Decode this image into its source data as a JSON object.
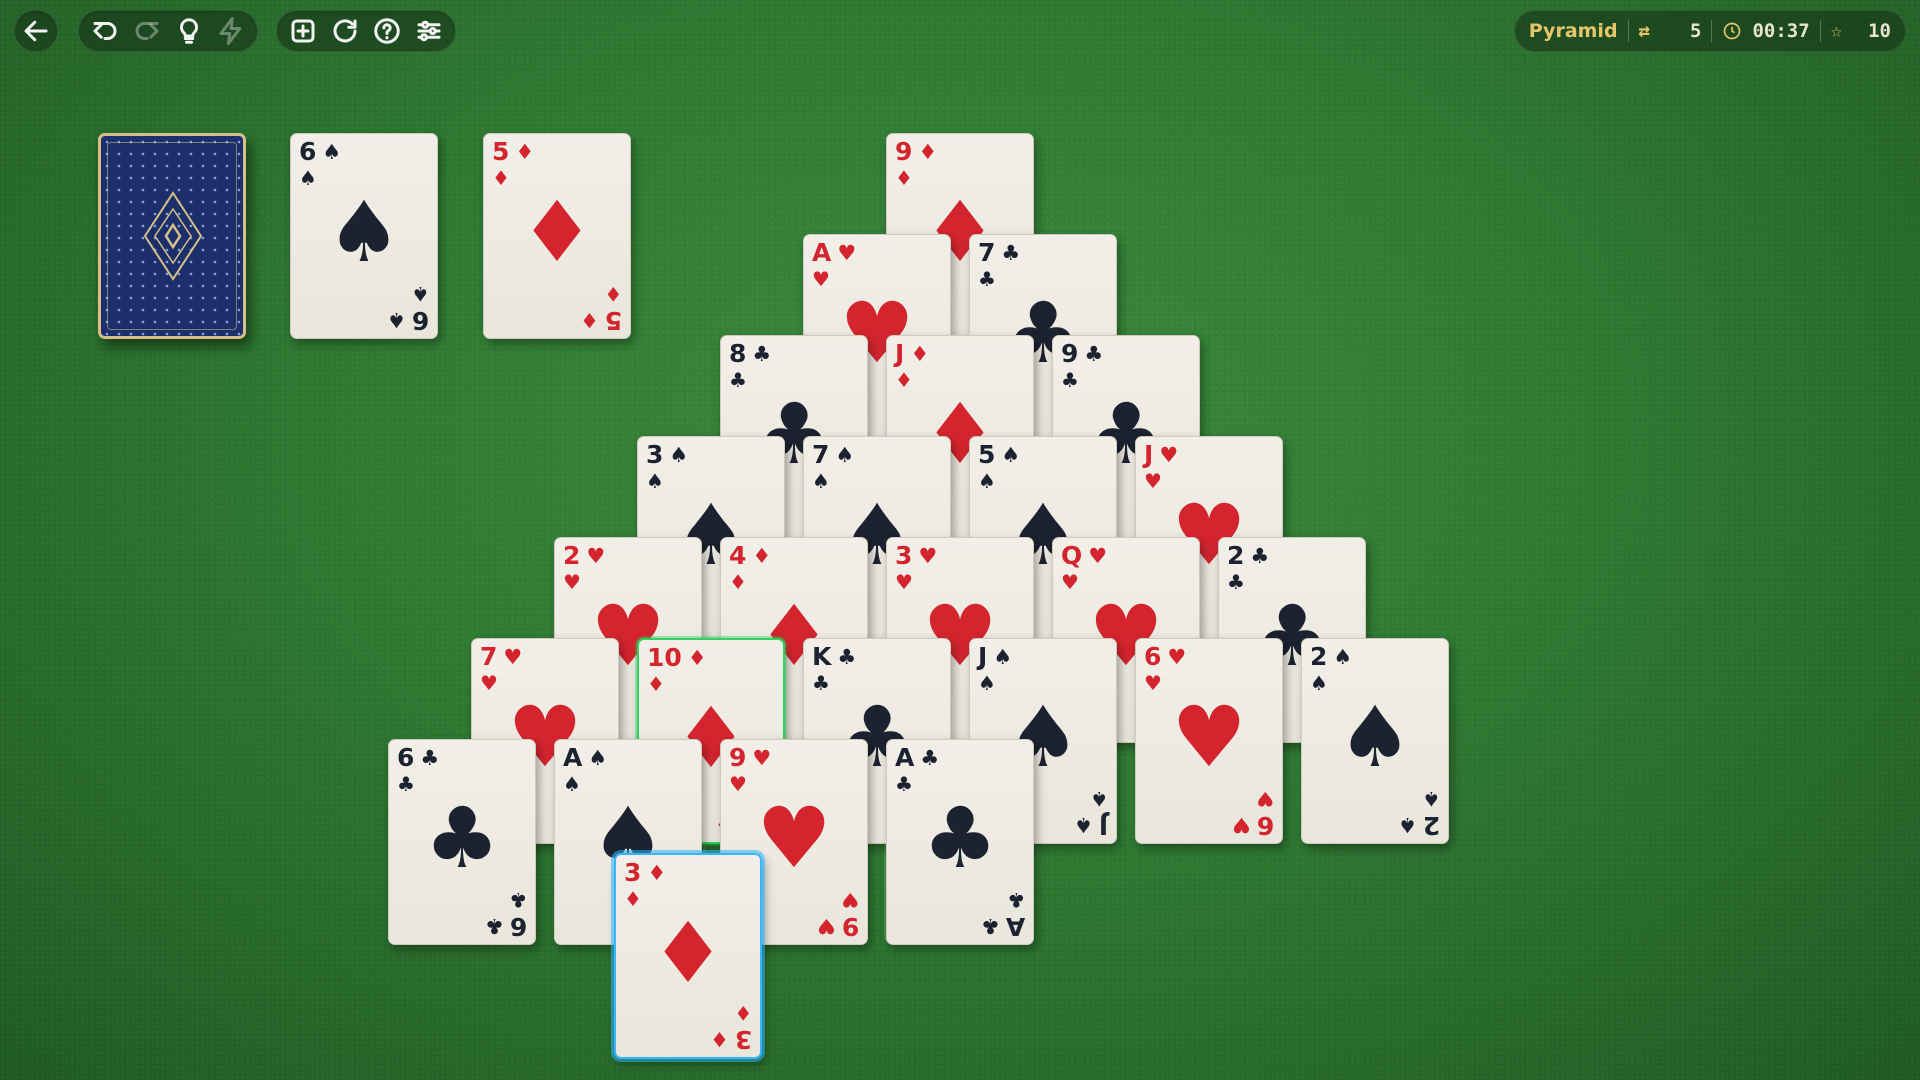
{
  "toolbar": {
    "buttons": [
      "back",
      "undo",
      "redo",
      "hint",
      "auto",
      "new-game",
      "restart",
      "help",
      "settings"
    ]
  },
  "status": {
    "mode": "Pyramid",
    "passes": "5",
    "time": "00:37",
    "score": "10"
  },
  "colors": {
    "red": "#d4252f",
    "black": "#1d2230",
    "felt": "#2f7a33",
    "accent": "#e7c66a"
  },
  "stock": {
    "face": "down"
  },
  "waste": [
    {
      "rank": "6",
      "suit": "♠",
      "color": "black"
    },
    {
      "rank": "5",
      "suit": "♦",
      "color": "red"
    }
  ],
  "pyramid": [
    {
      "rank": "9",
      "suit": "♦",
      "color": "red"
    },
    {
      "rank": "A",
      "suit": "♥",
      "color": "red"
    },
    {
      "rank": "7",
      "suit": "♣",
      "color": "black"
    },
    {
      "rank": "8",
      "suit": "♣",
      "color": "black"
    },
    {
      "rank": "J",
      "suit": "♦",
      "color": "red"
    },
    {
      "rank": "9",
      "suit": "♣",
      "color": "black"
    },
    {
      "rank": "3",
      "suit": "♠",
      "color": "black"
    },
    {
      "rank": "7",
      "suit": "♠",
      "color": "black"
    },
    {
      "rank": "5",
      "suit": "♠",
      "color": "black"
    },
    {
      "rank": "J",
      "suit": "♥",
      "color": "red"
    },
    {
      "rank": "2",
      "suit": "♥",
      "color": "red"
    },
    {
      "rank": "4",
      "suit": "♦",
      "color": "red"
    },
    {
      "rank": "3",
      "suit": "♥",
      "color": "red"
    },
    {
      "rank": "Q",
      "suit": "♥",
      "color": "red"
    },
    {
      "rank": "2",
      "suit": "♣",
      "color": "black"
    },
    {
      "rank": "7",
      "suit": "♥",
      "color": "red"
    },
    {
      "rank": "10",
      "suit": "♦",
      "color": "red",
      "selected": "green"
    },
    {
      "rank": "K",
      "suit": "♣",
      "color": "black"
    },
    {
      "rank": "J",
      "suit": "♠",
      "color": "black"
    },
    {
      "rank": "6",
      "suit": "♥",
      "color": "red"
    },
    {
      "rank": "2",
      "suit": "♠",
      "color": "black"
    },
    {
      "rank": "6",
      "suit": "♣",
      "color": "black"
    },
    {
      "rank": "A",
      "suit": "♠",
      "color": "black"
    },
    {
      "rank": "9",
      "suit": "♥",
      "color": "red"
    },
    {
      "rank": "A",
      "suit": "♣",
      "color": "black"
    }
  ],
  "dragging": {
    "rank": "3",
    "suit": "♦",
    "color": "red",
    "selected": "blue"
  }
}
